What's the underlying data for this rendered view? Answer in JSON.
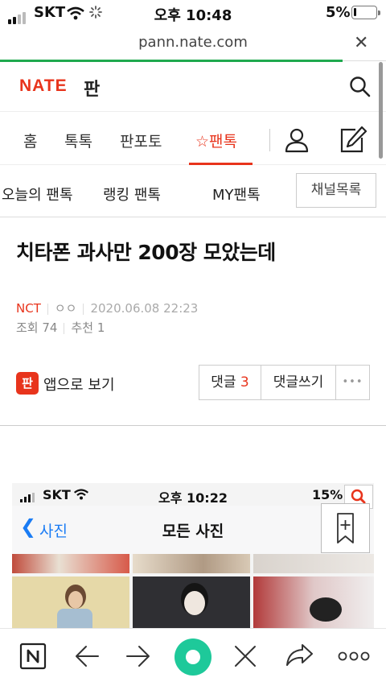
{
  "status_bar": {
    "carrier": "SKT",
    "time": "오후 10:48",
    "battery": "5%"
  },
  "browser": {
    "url": "pann.nate.com",
    "close_icon": "close-icon"
  },
  "header": {
    "logo": "NATE",
    "logo_sub": "판"
  },
  "main_nav": {
    "items": [
      "홈",
      "톡톡",
      "판포토",
      "☆팬톡"
    ],
    "active": "☆팬톡"
  },
  "sub_nav": {
    "items": [
      "오늘의 팬톡",
      "랭킹 팬톡",
      "MY팬톡"
    ],
    "channel_button": "채널목록"
  },
  "article": {
    "title": "치타폰 과사만 200장 모았는데",
    "category": "NCT",
    "author": "ㅇㅇ",
    "date": "2020.06.08 22:23",
    "views": "조회 74",
    "recommend": "추천 1",
    "app_badge": "판",
    "app_link": "앱으로 보기",
    "comments_label": "댓글",
    "comments_count": "3",
    "write_comment": "댓글쓰기",
    "more": "•••"
  },
  "embedded_image": {
    "carrier": "SKT",
    "time": "오후 10:22",
    "battery": "15%",
    "back_label": "사진",
    "title": "모든 사진"
  },
  "colors": {
    "brand": "#e8341c",
    "progress": "#1fa94f",
    "toolbar_center": "#1ec99a"
  }
}
